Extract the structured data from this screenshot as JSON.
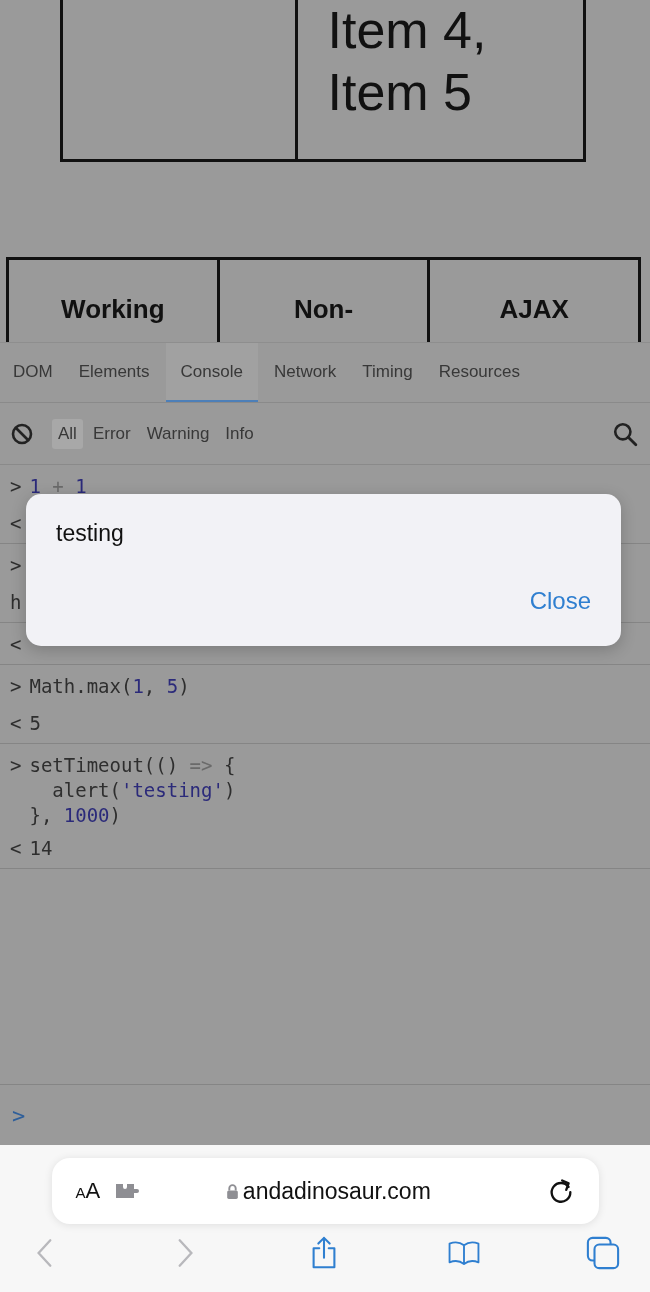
{
  "page": {
    "item_cell": "Item 4, Item 5",
    "buttons": [
      "Working",
      "Non-",
      "AJAX"
    ]
  },
  "devtools": {
    "tabs": [
      {
        "label": "DOM",
        "selected": false
      },
      {
        "label": "Elements",
        "selected": false
      },
      {
        "label": "Console",
        "selected": true
      },
      {
        "label": "Network",
        "selected": false
      },
      {
        "label": "Timing",
        "selected": false
      },
      {
        "label": "Resources",
        "selected": false
      }
    ],
    "filters": [
      {
        "label": "All",
        "selected": true
      },
      {
        "label": "Error",
        "selected": false
      },
      {
        "label": "Warning",
        "selected": false
      },
      {
        "label": "Info",
        "selected": false
      }
    ],
    "console": [
      {
        "rows": [
          {
            "marker": ">",
            "lines": [
              [
                {
                  "text": "1",
                  "kind": "number"
                },
                {
                  "text": " + ",
                  "kind": "operator"
                },
                {
                  "text": "1",
                  "kind": "number"
                }
              ]
            ]
          },
          {
            "marker": "<"
          }
        ]
      },
      {
        "rows": [
          {
            "marker": ">"
          },
          {
            "marker": "h"
          }
        ]
      },
      {
        "rows": [
          {
            "marker": "<"
          }
        ]
      },
      {
        "rows": [
          {
            "marker": ">",
            "lines": [
              [
                {
                  "text": "Math.max(",
                  "kind": "plain"
                },
                {
                  "text": "1",
                  "kind": "number"
                },
                {
                  "text": ", ",
                  "kind": "plain"
                },
                {
                  "text": "5",
                  "kind": "number"
                },
                {
                  "text": ")",
                  "kind": "plain"
                }
              ]
            ]
          },
          {
            "marker": "<",
            "lines": [
              [
                {
                  "text": "5",
                  "kind": "plain"
                }
              ]
            ]
          }
        ]
      },
      {
        "rows": [
          {
            "marker": ">",
            "lines": [
              [
                {
                  "text": "setTimeout(() ",
                  "kind": "plain"
                },
                {
                  "text": "=>",
                  "kind": "operator"
                },
                {
                  "text": " {",
                  "kind": "plain"
                }
              ],
              [
                {
                  "text": "  alert(",
                  "kind": "plain"
                },
                {
                  "text": "'testing'",
                  "kind": "string"
                },
                {
                  "text": ")",
                  "kind": "plain"
                }
              ],
              [
                {
                  "text": "}, ",
                  "kind": "plain"
                },
                {
                  "text": "1000",
                  "kind": "number"
                },
                {
                  "text": ")",
                  "kind": "plain"
                }
              ]
            ]
          },
          {
            "marker": "<",
            "lines": [
              [
                {
                  "text": "14",
                  "kind": "plain"
                }
              ]
            ]
          }
        ]
      }
    ],
    "prompt": ">"
  },
  "alert": {
    "message": "testing",
    "button": "Close"
  },
  "browser": {
    "text_size_label": "AA",
    "url": "andadinosaur.com",
    "back_disabled": true,
    "forward_disabled": true
  }
}
